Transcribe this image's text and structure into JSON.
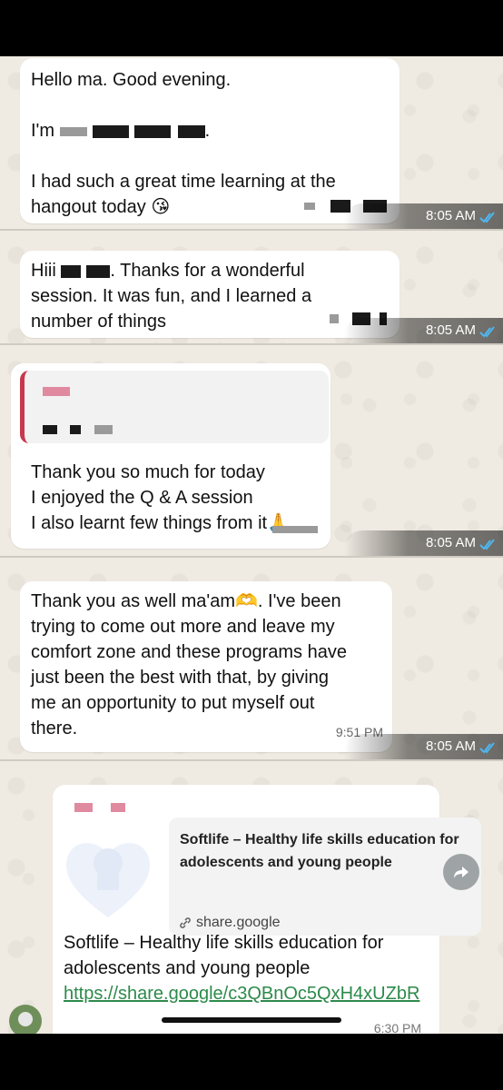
{
  "messages": [
    {
      "lines": [
        "Hello ma. Good evening.",
        "",
        "I'm",
        "",
        "I had such a great time learning at the",
        "hangout today 😘"
      ],
      "timestamp": "8:05 AM"
    },
    {
      "line1_a": "Hiii",
      "line1_b": ". Thanks for a wonderful",
      "line2": "session. It was fun, and I learned a",
      "line3": "number of things",
      "timestamp": "8:05 AM"
    },
    {
      "lines": [
        "Thank you so much for today",
        "I enjoyed the Q & A session",
        "I also learnt few things from it🙏"
      ],
      "timestamp": "8:05 AM"
    },
    {
      "lines": [
        "Thank you as well ma'am🫶. I've been",
        "trying to come out more and leave my",
        "comfort zone and these programs have",
        "just been the best with that, by giving",
        "me an opportunity to put myself out",
        "there."
      ],
      "inner_time": "9:51 PM",
      "timestamp": "8:05 AM"
    },
    {
      "card_title": "Softlife – Healthy life skills education for adolescents and young people",
      "card_domain": "share.google",
      "body": "Softlife – Healthy life skills education for adolescents and young people ",
      "link": "https://share.google/c3QBnOc5QxH4xUZbR",
      "time": "6:30 PM"
    }
  ],
  "icons": {
    "read_ticks": "double-check-icon",
    "forward": "forward-icon",
    "link": "link-icon"
  },
  "colors": {
    "tick_blue": "#4fb6ec",
    "link_green": "#2d8a4a",
    "quote_bar": "#c8384c"
  }
}
